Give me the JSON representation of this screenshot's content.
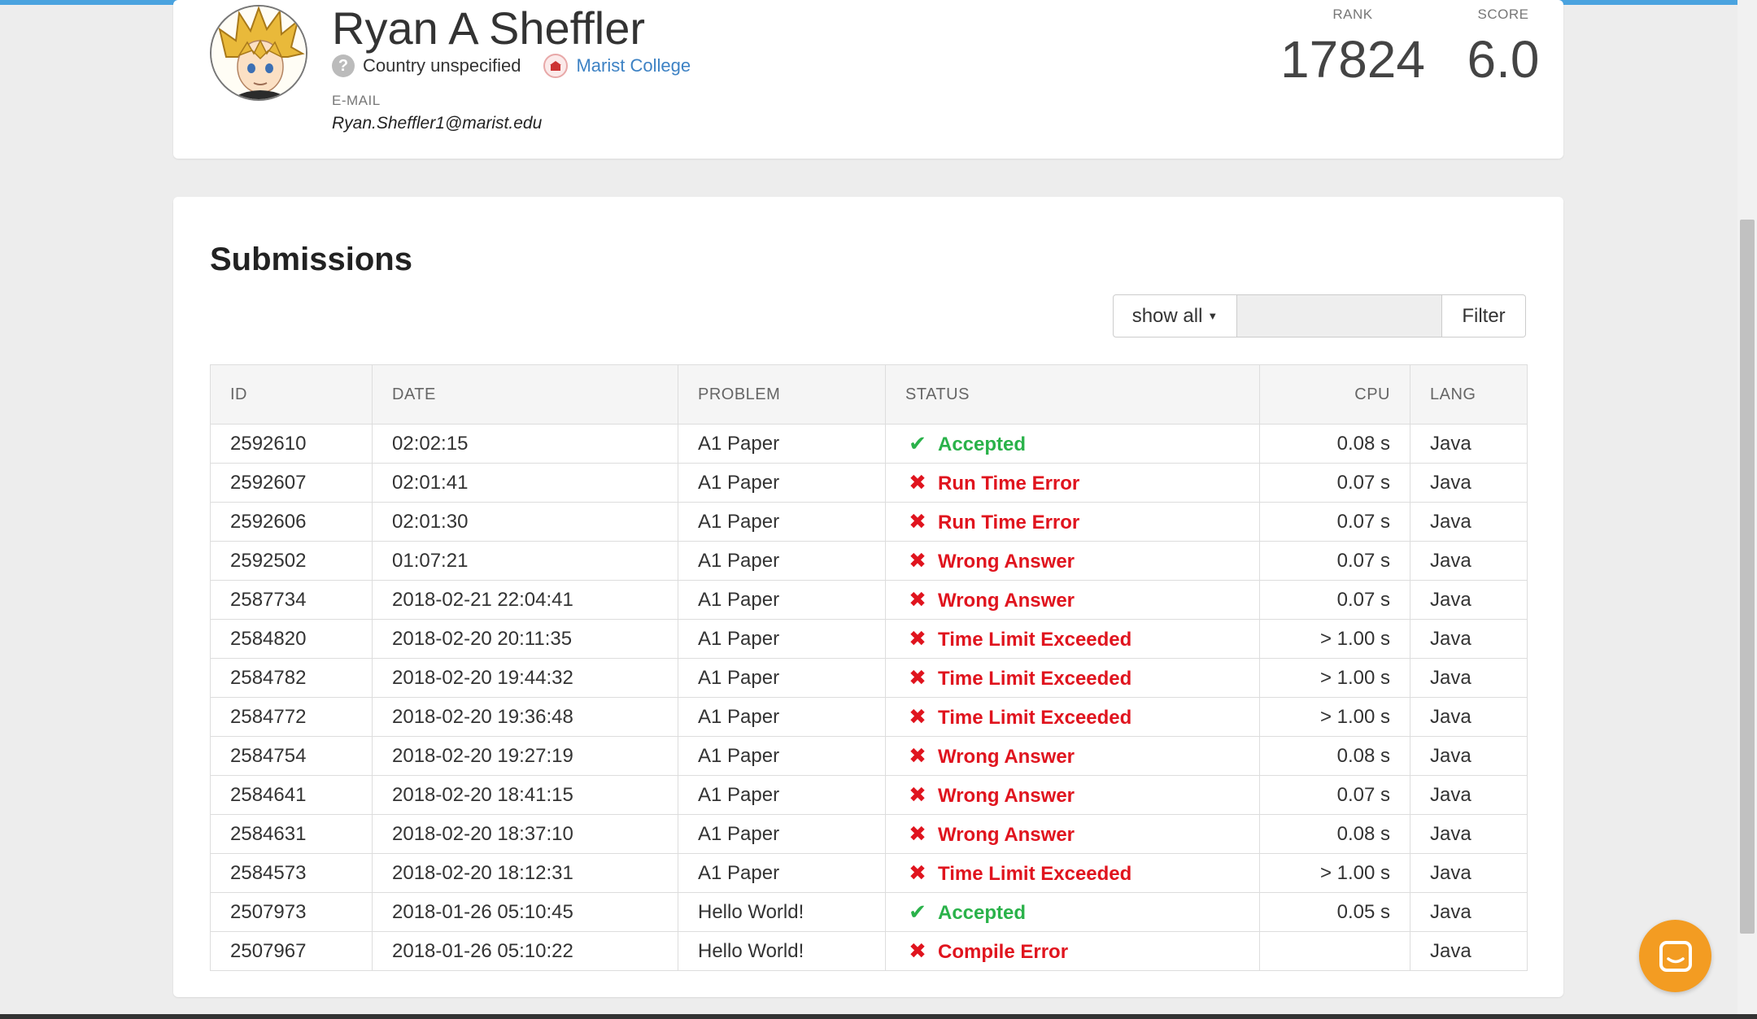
{
  "profile": {
    "name": "Ryan A Sheffler",
    "country": "Country unspecified",
    "country_icon_glyph": "?",
    "college": "Marist College",
    "email_label": "E-MAIL",
    "email": "Ryan.Sheffler1@marist.edu",
    "rank_label": "RANK",
    "rank": "17824",
    "score_label": "SCORE",
    "score": "6.0"
  },
  "submissions": {
    "title": "Submissions",
    "filter": {
      "dropdown_label": "show all",
      "input_value": "",
      "button_label": "Filter"
    },
    "columns": [
      "ID",
      "DATE",
      "PROBLEM",
      "STATUS",
      "CPU",
      "LANG"
    ],
    "rows": [
      {
        "id": "2592610",
        "date": "02:02:15",
        "problem": "A1 Paper",
        "status": "Accepted",
        "ok": true,
        "cpu": "0.08 s",
        "lang": "Java"
      },
      {
        "id": "2592607",
        "date": "02:01:41",
        "problem": "A1 Paper",
        "status": "Run Time Error",
        "ok": false,
        "cpu": "0.07 s",
        "lang": "Java"
      },
      {
        "id": "2592606",
        "date": "02:01:30",
        "problem": "A1 Paper",
        "status": "Run Time Error",
        "ok": false,
        "cpu": "0.07 s",
        "lang": "Java"
      },
      {
        "id": "2592502",
        "date": "01:07:21",
        "problem": "A1 Paper",
        "status": "Wrong Answer",
        "ok": false,
        "cpu": "0.07 s",
        "lang": "Java"
      },
      {
        "id": "2587734",
        "date": "2018-02-21 22:04:41",
        "problem": "A1 Paper",
        "status": "Wrong Answer",
        "ok": false,
        "cpu": "0.07 s",
        "lang": "Java"
      },
      {
        "id": "2584820",
        "date": "2018-02-20 20:11:35",
        "problem": "A1 Paper",
        "status": "Time Limit Exceeded",
        "ok": false,
        "cpu": "> 1.00 s",
        "lang": "Java"
      },
      {
        "id": "2584782",
        "date": "2018-02-20 19:44:32",
        "problem": "A1 Paper",
        "status": "Time Limit Exceeded",
        "ok": false,
        "cpu": "> 1.00 s",
        "lang": "Java"
      },
      {
        "id": "2584772",
        "date": "2018-02-20 19:36:48",
        "problem": "A1 Paper",
        "status": "Time Limit Exceeded",
        "ok": false,
        "cpu": "> 1.00 s",
        "lang": "Java"
      },
      {
        "id": "2584754",
        "date": "2018-02-20 19:27:19",
        "problem": "A1 Paper",
        "status": "Wrong Answer",
        "ok": false,
        "cpu": "0.08 s",
        "lang": "Java"
      },
      {
        "id": "2584641",
        "date": "2018-02-20 18:41:15",
        "problem": "A1 Paper",
        "status": "Wrong Answer",
        "ok": false,
        "cpu": "0.07 s",
        "lang": "Java"
      },
      {
        "id": "2584631",
        "date": "2018-02-20 18:37:10",
        "problem": "A1 Paper",
        "status": "Wrong Answer",
        "ok": false,
        "cpu": "0.08 s",
        "lang": "Java"
      },
      {
        "id": "2584573",
        "date": "2018-02-20 18:12:31",
        "problem": "A1 Paper",
        "status": "Time Limit Exceeded",
        "ok": false,
        "cpu": "> 1.00 s",
        "lang": "Java"
      },
      {
        "id": "2507973",
        "date": "2018-01-26 05:10:45",
        "problem": "Hello World!",
        "status": "Accepted",
        "ok": true,
        "cpu": "0.05 s",
        "lang": "Java"
      },
      {
        "id": "2507967",
        "date": "2018-01-26 05:10:22",
        "problem": "Hello World!",
        "status": "Compile Error",
        "ok": false,
        "cpu": "",
        "lang": "Java"
      }
    ]
  },
  "status_glyphs": {
    "accepted": "✔",
    "rejected": "✖"
  },
  "colors": {
    "link": "#3d82c4",
    "accepted": "#2ab24a",
    "rejected": "#e0141e",
    "chat": "#f39c22",
    "topbar": "#4aa3df"
  }
}
